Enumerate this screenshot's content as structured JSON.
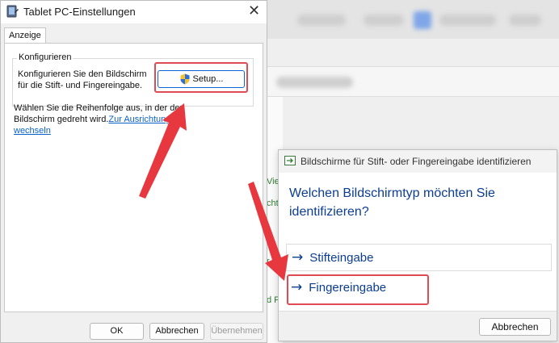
{
  "colors": {
    "accent": "#0b3d91",
    "link": "#0b62c9",
    "highlight": "#e04a52",
    "annotation_arrow": "#e8383f"
  },
  "background_window": {
    "green_text_fragments": [
      "Vie",
      "cht",
      "r",
      "d F"
    ]
  },
  "tablet_window": {
    "title": "Tablet PC-Einstellungen",
    "close_glyph": "✕",
    "tab": "Anzeige",
    "group_label": "Konfigurieren",
    "group_text": "Konfigurieren Sie den Bildschirm für die Stift- und Fingereingabe.",
    "setup_button": "Setup...",
    "order_text": "Wählen Sie die Reihenfolge aus, in der der Bildschirm gedreht wird.",
    "order_link": "Zur Ausrichtung wechseln",
    "ok_button": "OK",
    "cancel_button": "Abbrechen",
    "apply_button": "Übernehmen"
  },
  "identify_dialog": {
    "title": "Bildschirme für Stift- oder Fingereingabe identifizieren",
    "question": "Welchen Bildschirmtyp möchten Sie identifizieren?",
    "pen_option": "Stifteingabe",
    "touch_option": "Fingereingabe",
    "arrow_glyph": "→",
    "cancel_button": "Abbrechen"
  }
}
